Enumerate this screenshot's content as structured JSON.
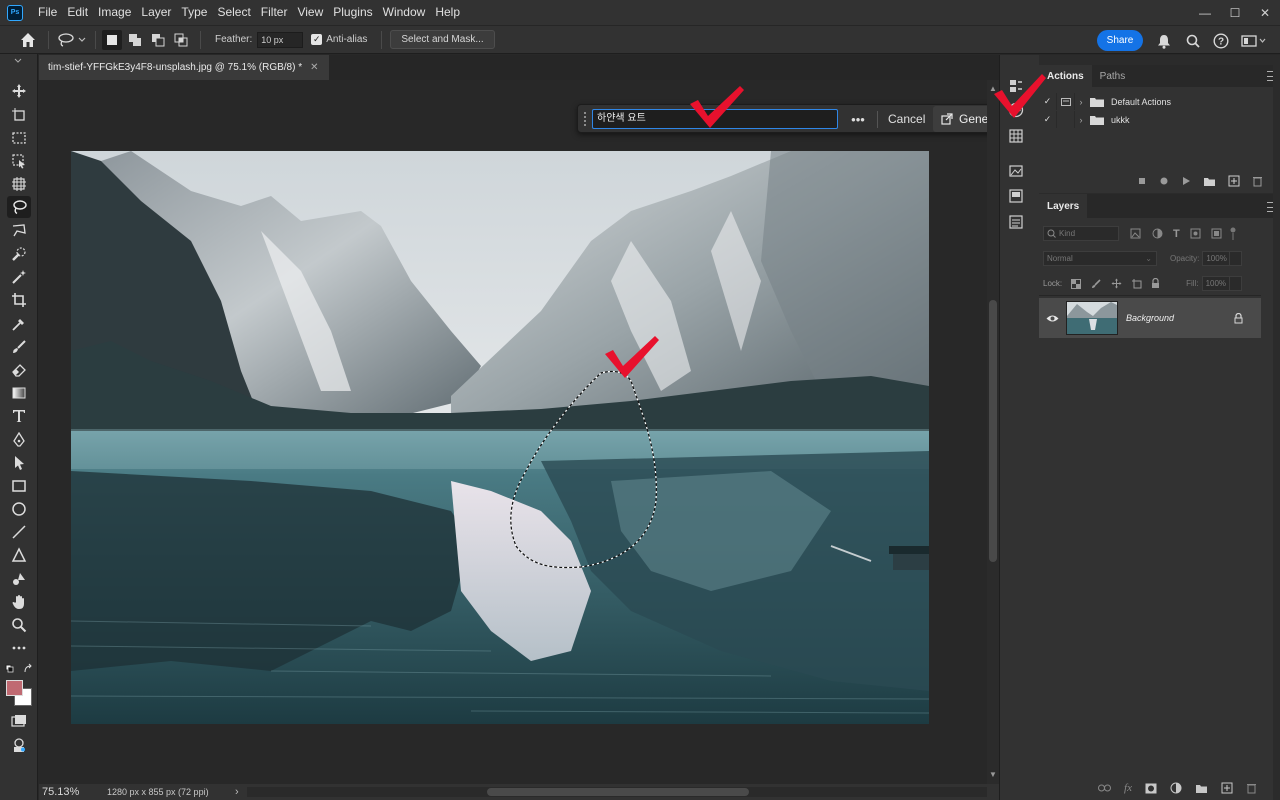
{
  "app": {
    "logo_text": "Ps",
    "menu": [
      "File",
      "Edit",
      "Image",
      "Layer",
      "Type",
      "Select",
      "Filter",
      "View",
      "Plugins",
      "Window",
      "Help"
    ]
  },
  "window_controls": {
    "minimize": "—",
    "maximize": "☐",
    "close": "✕"
  },
  "options_bar": {
    "feather_label": "Feather:",
    "feather_value": "10 px",
    "antialias_label": "Anti-alias",
    "antialias_checked": true,
    "select_mask_label": "Select and Mask...",
    "share_label": "Share"
  },
  "document": {
    "tab_title": "tim-stief-YFFGkE3y4F8-unsplash.jpg @ 75.1% (RGB/8) *",
    "close_icon": "✕"
  },
  "contextual_taskbar": {
    "prompt_value": "하얀색 요트",
    "more_icon": "•••",
    "cancel_label": "Cancel",
    "generate_label": "Generate"
  },
  "statusbar": {
    "zoom": "75.13%",
    "doc_info": "1280 px x 855 px (72 ppi)",
    "arrow": "›"
  },
  "actions_panel": {
    "tabs": [
      "Actions",
      "Paths"
    ],
    "active_tab": "Actions",
    "rows": [
      {
        "name": "Default Actions",
        "checked": true
      },
      {
        "name": "ukkk",
        "checked": true
      }
    ]
  },
  "layers_panel": {
    "tab": "Layers",
    "filter_placeholder": "Kind",
    "blend_mode": "Normal",
    "opacity_label": "Opacity:",
    "opacity_value": "100%",
    "lock_label": "Lock:",
    "fill_label": "Fill:",
    "fill_value": "100%",
    "layer": {
      "name": "Background",
      "visible": true,
      "locked": true
    }
  },
  "colors": {
    "accent_blue": "#1473e6",
    "foreground_swatch": "#c06a72",
    "background_swatch": "#ffffff",
    "annotation_red": "#e8112d"
  }
}
